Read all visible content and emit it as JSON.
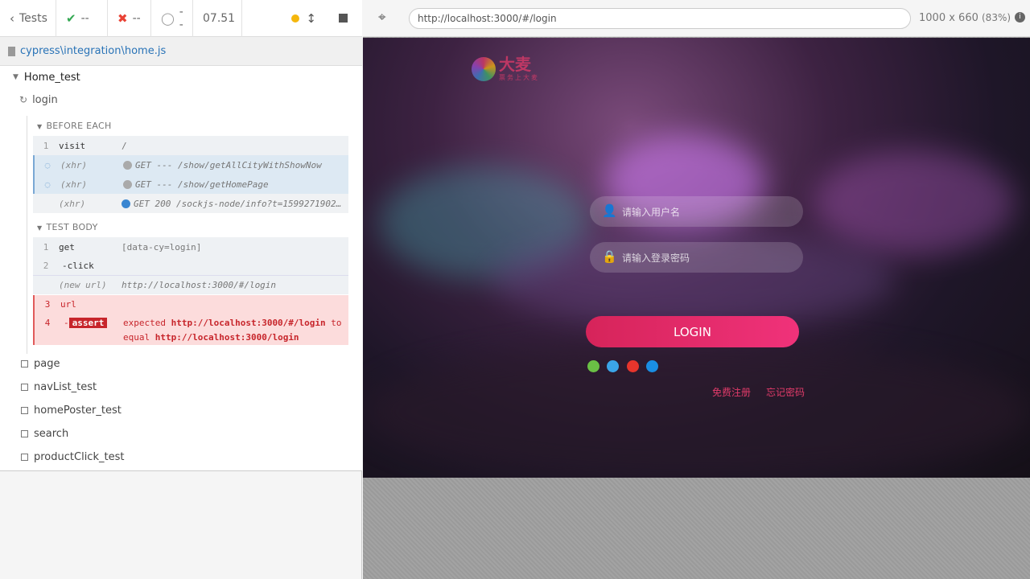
{
  "topbar": {
    "tests_label": "Tests",
    "passed": "--",
    "failed": "--",
    "pending": "--",
    "duration": "07.51"
  },
  "spec_file": "cypress\\integration\\home.js",
  "tree": {
    "suite": "Home_test",
    "current_test": "login",
    "before_each_label": "BEFORE EACH",
    "test_body_label": "TEST BODY",
    "before_each": [
      {
        "num": "1",
        "name": "visit",
        "msg": "/"
      },
      {
        "num": "",
        "name": "(xhr)",
        "msg": "GET --- /show/getAllCityWithShowNow"
      },
      {
        "num": "",
        "name": "(xhr)",
        "msg": "GET --- /show/getHomePage"
      },
      {
        "num": "",
        "name": "(xhr)",
        "msg": "GET 200 /sockjs-node/info?t=1599271902…"
      }
    ],
    "body": [
      {
        "num": "1",
        "name": "get",
        "msg": "[data-cy=login]"
      },
      {
        "num": "2",
        "name": "-click",
        "msg": ""
      },
      {
        "num": "",
        "name": "(new url)",
        "msg": "http://localhost:3000/#/login"
      }
    ],
    "error": {
      "num3": "3",
      "name3": "url",
      "num4": "4",
      "dash": "-",
      "badge": "assert",
      "expected": "expected",
      "url1": "http://localhost:3000/#/login",
      "to": "to",
      "equal": "equal",
      "url2": "http://localhost:3000/login"
    },
    "other_tests": [
      "page",
      "navList_test",
      "homePoster_test",
      "search",
      "productClick_test"
    ]
  },
  "browser": {
    "url": "http://localhost:3000/#/login",
    "size": "1000 x 660",
    "zoom": "(83%)"
  },
  "app": {
    "logo_text": "大麦",
    "logo_sub": "票务上大麦",
    "username_placeholder": "请输入用户名",
    "password_placeholder": "请输入登录密码",
    "login_button": "LOGIN",
    "register_link": "免费注册",
    "forgot_link": "忘记密码"
  },
  "colors": {
    "accent": "#f0327a",
    "pass": "#34a853",
    "fail": "#e94235",
    "link": "#2973b7"
  }
}
